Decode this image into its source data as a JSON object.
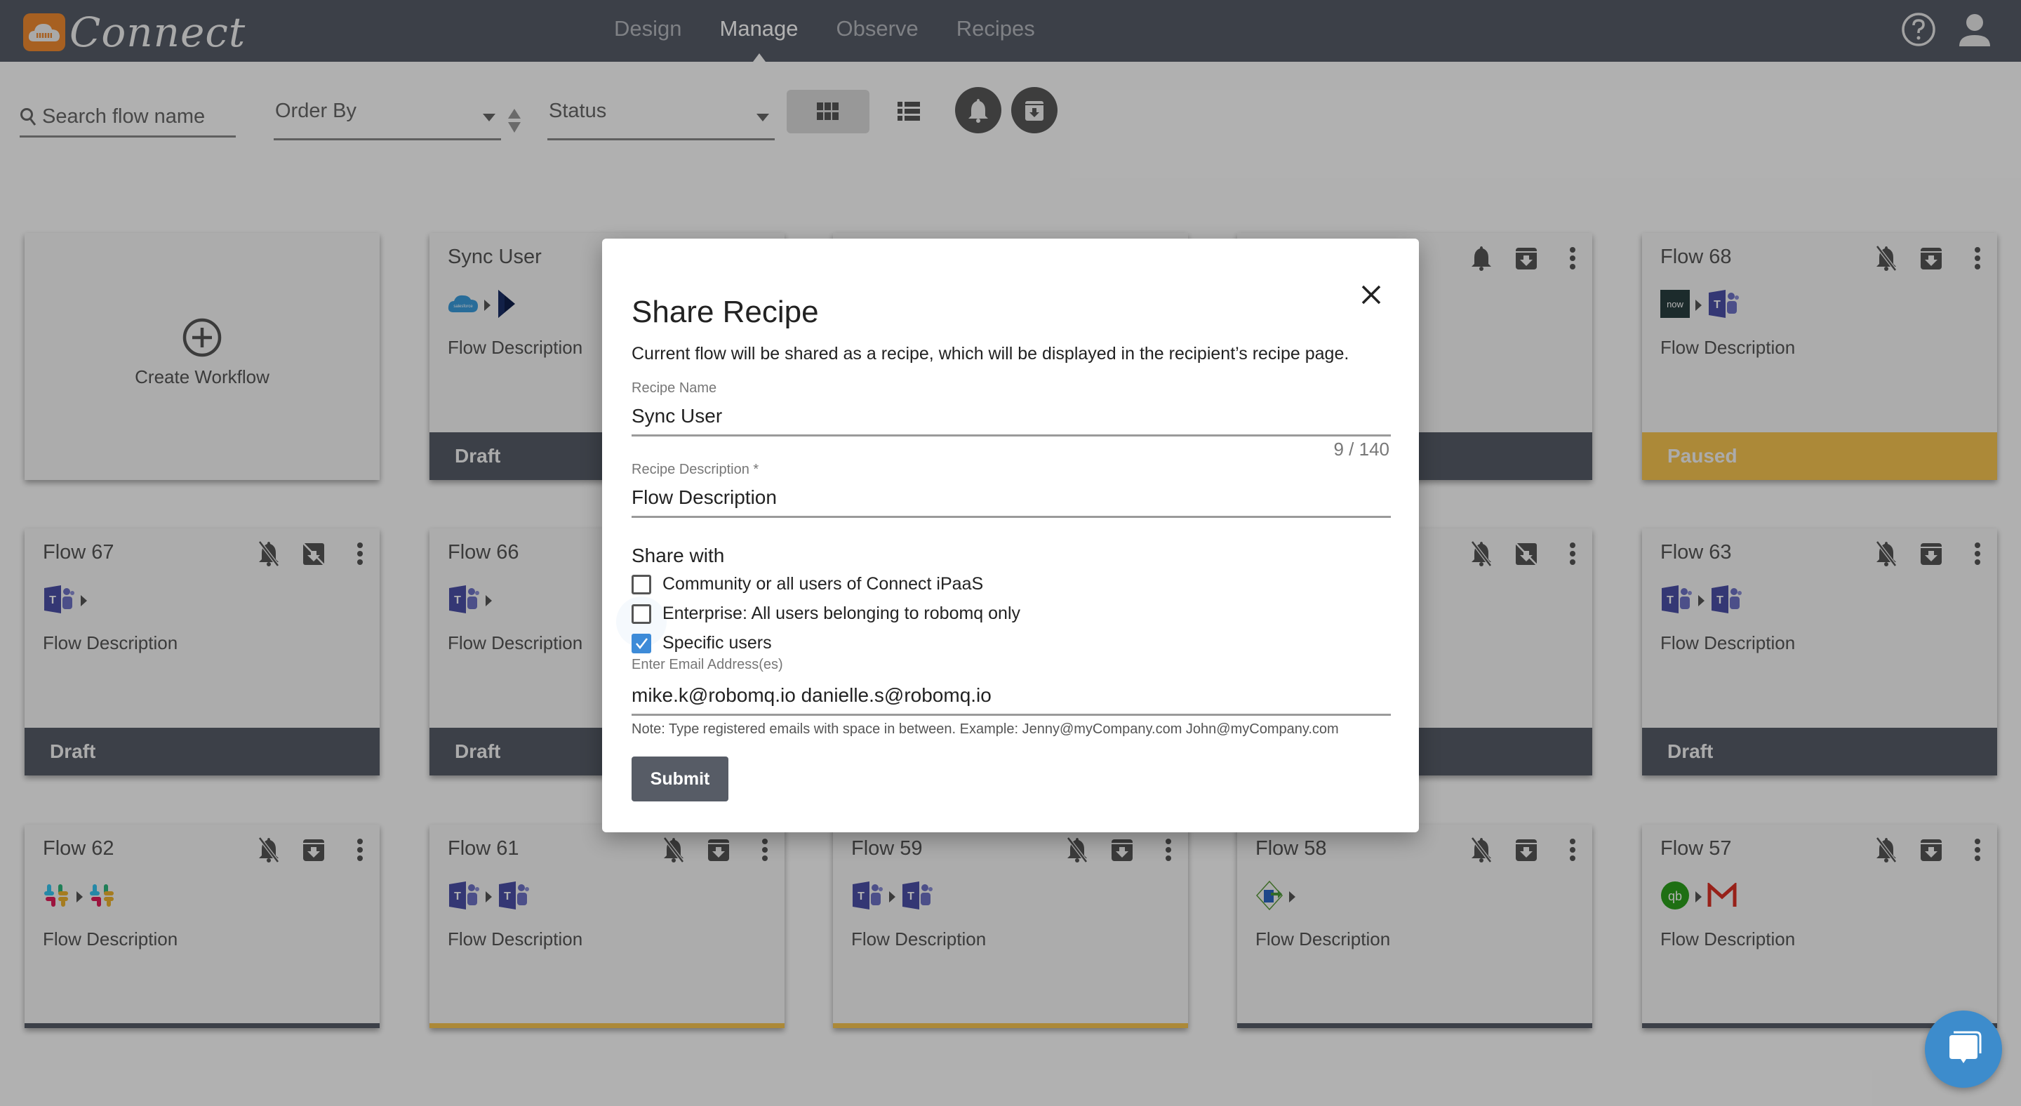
{
  "header": {
    "app_name": "Connect",
    "nav": [
      {
        "label": "Design",
        "active": false
      },
      {
        "label": "Manage",
        "active": true
      },
      {
        "label": "Observe",
        "active": false
      },
      {
        "label": "Recipes",
        "active": false
      }
    ],
    "icons": [
      "help-icon",
      "account-icon"
    ]
  },
  "toolbar": {
    "search_placeholder": "Search flow name",
    "order_by_label": "Order By",
    "status_label": "Status",
    "view_modes": [
      "grid",
      "list"
    ],
    "active_view": "grid"
  },
  "create_card": {
    "label": "Create Workflow"
  },
  "cards": [
    {
      "title": "Sync User",
      "apps": [
        "salesforce",
        "dynamics"
      ],
      "description": "Flow Description",
      "status": "Draft",
      "notifications": "on",
      "archive": "enabled"
    },
    {
      "title": "",
      "apps": [],
      "description": "",
      "status": "",
      "notifications": "on",
      "archive": "enabled"
    },
    {
      "title": "",
      "apps": [],
      "description": "",
      "status": "",
      "notifications": "on",
      "archive": "enabled"
    },
    {
      "title": "Flow 68",
      "apps": [
        "servicenow",
        "teams"
      ],
      "description": "Flow Description",
      "status": "Paused",
      "notifications": "off",
      "archive": "enabled"
    },
    {
      "title": "Flow 67",
      "apps": [
        "teams"
      ],
      "description": "Flow Description",
      "status": "Draft",
      "notifications": "off",
      "archive": "disabled"
    },
    {
      "title": "Flow 66",
      "apps": [
        "teams"
      ],
      "description": "Flow Description",
      "status": "Draft",
      "notifications": "off",
      "archive": "disabled"
    },
    {
      "title": "",
      "apps": [],
      "description": "",
      "status": "",
      "notifications": "off",
      "archive": "disabled"
    },
    {
      "title": "",
      "apps": [],
      "description": "",
      "status": "",
      "notifications": "off",
      "archive": "disabled"
    },
    {
      "title": "Flow 63",
      "apps": [
        "teams",
        "teams"
      ],
      "description": "Flow Description",
      "status": "Draft",
      "notifications": "off",
      "archive": "enabled"
    },
    {
      "title": "Flow 62",
      "apps": [
        "slack",
        "slack"
      ],
      "description": "Flow Description",
      "status": "draft-line",
      "notifications": "off",
      "archive": "enabled"
    },
    {
      "title": "Flow 61",
      "apps": [
        "teams",
        "teams"
      ],
      "description": "Flow Description",
      "status": "paused-line",
      "notifications": "off",
      "archive": "enabled"
    },
    {
      "title": "Flow 59",
      "apps": [
        "teams",
        "teams"
      ],
      "description": "Flow Description",
      "status": "paused-line",
      "notifications": "off",
      "archive": "enabled"
    },
    {
      "title": "Flow 58",
      "apps": [
        "file-transfer"
      ],
      "description": "Flow Description",
      "status": "draft-line",
      "notifications": "off",
      "archive": "enabled"
    },
    {
      "title": "Flow 57",
      "apps": [
        "quickbooks",
        "gmail"
      ],
      "description": "Flow Description",
      "status": "draft-line",
      "notifications": "off",
      "archive": "enabled"
    }
  ],
  "modal": {
    "title": "Share Recipe",
    "subtitle": "Current flow will be shared as a recipe, which will be displayed in the recipient’s recipe page.",
    "recipe_name_label": "Recipe Name",
    "recipe_name_value": "Sync User",
    "recipe_name_counter": "9 / 140",
    "recipe_description_label": "Recipe Description *",
    "recipe_description_value": "Flow Description",
    "share_with_label": "Share with",
    "options": [
      {
        "label": "Community or all users of Connect iPaaS",
        "checked": false
      },
      {
        "label": "Enterprise: All users belonging to robomq only",
        "checked": false
      },
      {
        "label": "Specific users",
        "checked": true
      }
    ],
    "email_label": "Enter Email Address(es)",
    "email_value": "mike.k@robomq.io danielle.s@robomq.io",
    "note": "Note: Type registered emails with space in between. Example: Jenny@myCompany.com John@myCompany.com",
    "submit_label": "Submit"
  },
  "colors": {
    "header": "#575c68",
    "draft": "#575c68",
    "paused": "#f7c551",
    "accent": "#3d8bd8",
    "logo": "#f08a30"
  }
}
